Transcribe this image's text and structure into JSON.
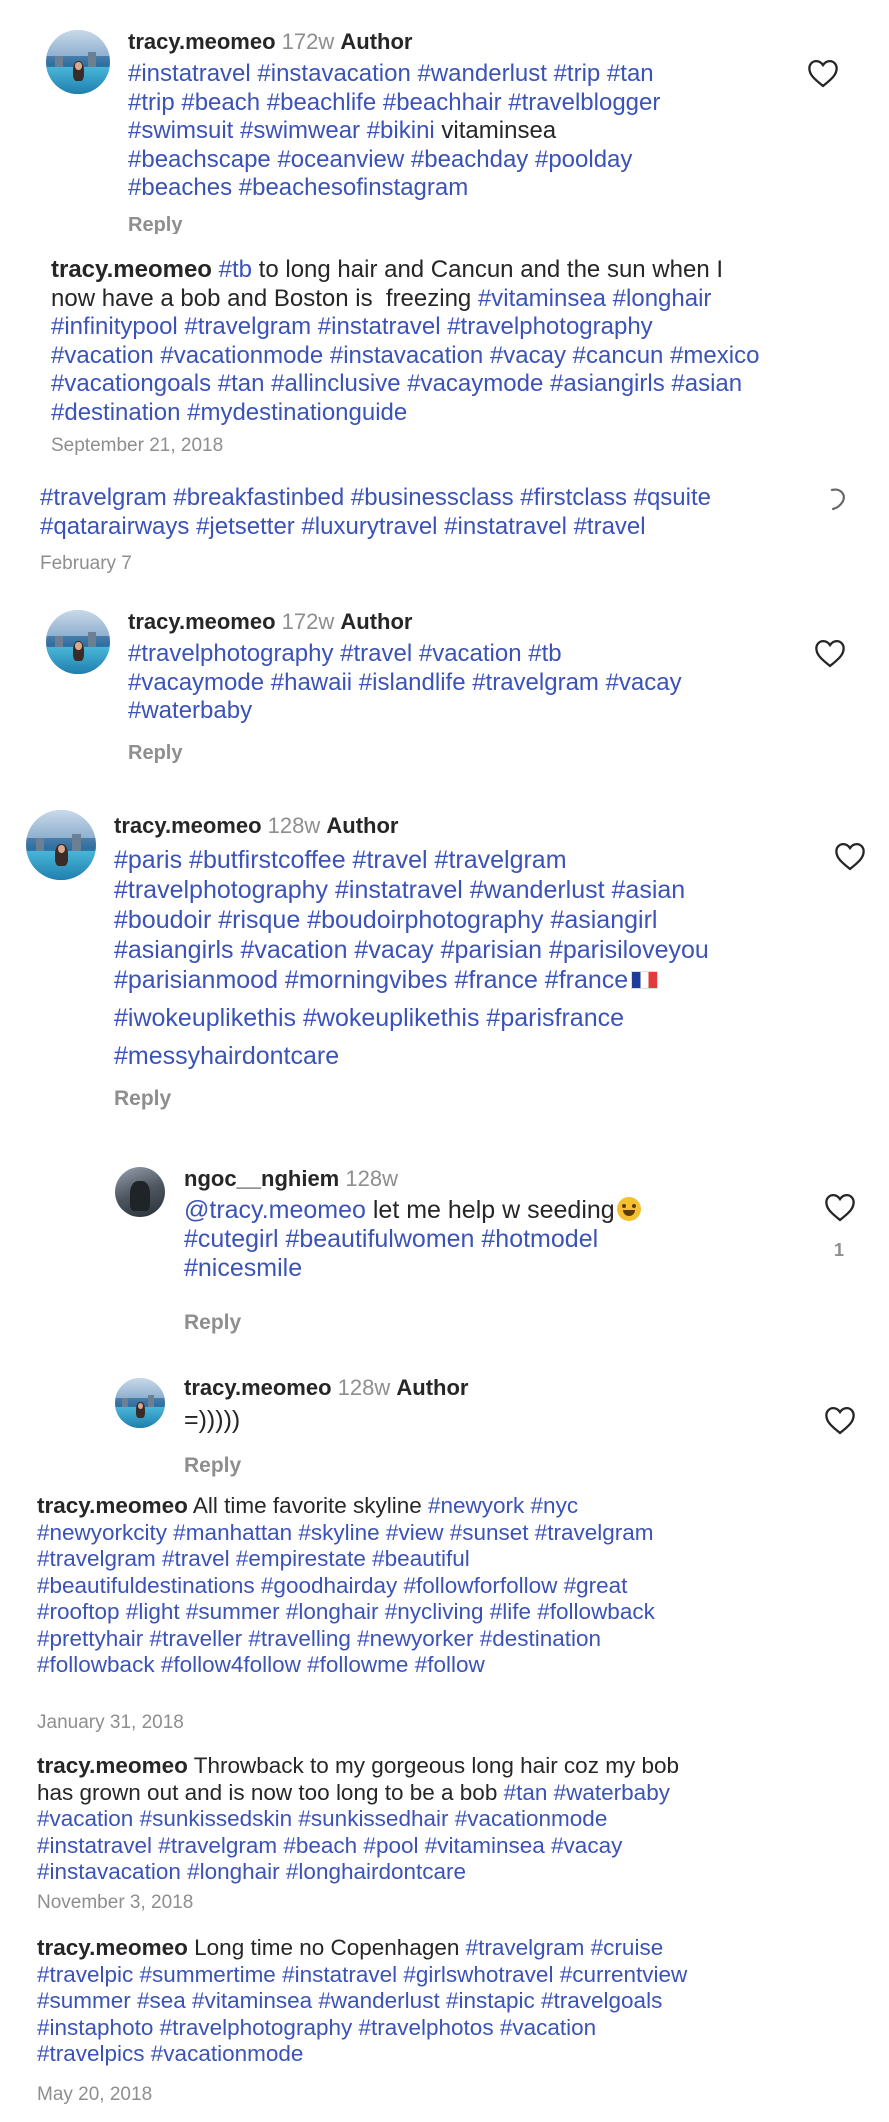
{
  "comments": [
    {
      "username": "tracy.meomeo",
      "time": "172w",
      "author_badge": "Author",
      "lines": [
        [
          "#instatravel #instavacation #wanderlust #trip #tan"
        ],
        [
          "#trip #beach #beachlife #beachhair #travelblogger"
        ],
        [
          "#swimsuit #swimwear #bikini",
          " vitaminsea"
        ],
        [
          "#beachscape #oceanview #beachday #poolday"
        ],
        [
          "#beaches #beachesofinstagram"
        ]
      ],
      "reply": "Reply"
    },
    {
      "username": "tracy.meomeo",
      "lines": [
        [
          "#tb",
          " to long hair and Cancun and the sun when I"
        ],
        [
          "now have a bob and Boston is  freezing ",
          "#vitaminsea #longhair"
        ],
        [
          "#infinitypool #travelgram #instatravel #travelphotography"
        ],
        [
          "#vacation #vacationmode #instavacation #vacay #cancun #mexico"
        ],
        [
          "#vacationgoals #tan #allinclusive #vacaymode #asiangirls #asian"
        ],
        [
          "#destination #mydestinationguide"
        ]
      ],
      "date": "September 21, 2018"
    },
    {
      "lines": [
        [
          "#travelgram #breakfastinbed #businessclass #firstclass #qsuite"
        ],
        [
          "#qatarairways #jetsetter #luxurytravel #instatravel #travel"
        ]
      ],
      "date": "February 7"
    },
    {
      "username": "tracy.meomeo",
      "time": "172w",
      "author_badge": "Author",
      "lines": [
        [
          "#travelphotography #travel #vacation #tb"
        ],
        [
          "#vacaymode #hawaii #islandlife #travelgram #vacay"
        ],
        [
          "#waterbaby"
        ]
      ],
      "reply": "Reply"
    },
    {
      "username": "tracy.meomeo",
      "time": "128w",
      "author_badge": "Author",
      "lines": [
        [
          "#paris #butfirstcoffee #travel #travelgram"
        ],
        [
          "#travelphotography #instatravel #wanderlust #asian"
        ],
        [
          "#boudoir #risque #boudoirphotography #asiangirl"
        ],
        [
          "#asiangirls #vacation #vacay #parisian #parisiloveyou"
        ],
        [
          "#parisianmood #morningvibes #france #france"
        ],
        [
          "#iwokeuplikethis #wokeuplikethis #parisfrance"
        ],
        [
          "#messyhairdontcare"
        ]
      ],
      "reply": "Reply"
    },
    {
      "username": "ngoc__nghiem",
      "time": "128w",
      "lines": [
        [
          "@tracy.meomeo",
          " let me help w seeding"
        ],
        [
          "#cutegirl #beautifulwomen #hotmodel"
        ],
        [
          "#nicesmile"
        ]
      ],
      "reply": "Reply",
      "likes": "1"
    },
    {
      "username": "tracy.meomeo",
      "time": "128w",
      "author_badge": "Author",
      "lines": [
        [
          "=)))))"
        ]
      ],
      "reply": "Reply"
    },
    {
      "username": "tracy.meomeo",
      "lines": [
        [
          " All time favorite skyline ",
          "#newyork #nyc"
        ],
        [
          "#newyorkcity #manhattan #skyline #view #sunset #travelgram"
        ],
        [
          "#travelgram #travel #empirestate #beautiful"
        ],
        [
          "#beautifuldestinations #goodhairday #followforfollow #great"
        ],
        [
          "#rooftop #light #summer #longhair #nycliving #life #followback"
        ],
        [
          "#prettyhair #traveller #travelling #newyorker #destination"
        ],
        [
          "#followback #follow4follow #followme #follow"
        ]
      ],
      "date": "January 31, 2018"
    },
    {
      "username": "tracy.meomeo",
      "lines": [
        [
          " Throwback to my gorgeous long hair coz my bob"
        ],
        [
          "has grown out and is now too long to be a bob ",
          "#tan #waterbaby"
        ],
        [
          "#vacation #sunkissedskin #sunkissedhair #vacationmode"
        ],
        [
          "#instatravel #travelgram #beach #pool #vitaminsea #vacay"
        ],
        [
          "#instavacation #longhair #longhairdontcare"
        ]
      ],
      "date": "November 3, 2018"
    },
    {
      "username": "tracy.meomeo",
      "lines": [
        [
          " Long time no Copenhagen ",
          "#travelgram #cruise"
        ],
        [
          "#travelpic #summertime #instatravel #girlswhotravel #currentview"
        ],
        [
          "#summer #sea #vitaminsea #wanderlust #instapic #travelgoals"
        ],
        [
          "#instaphoto #travelphotography #travelphotos #vacation"
        ],
        [
          "#travelpics #vacationmode"
        ]
      ],
      "date": "May 20, 2018"
    }
  ]
}
